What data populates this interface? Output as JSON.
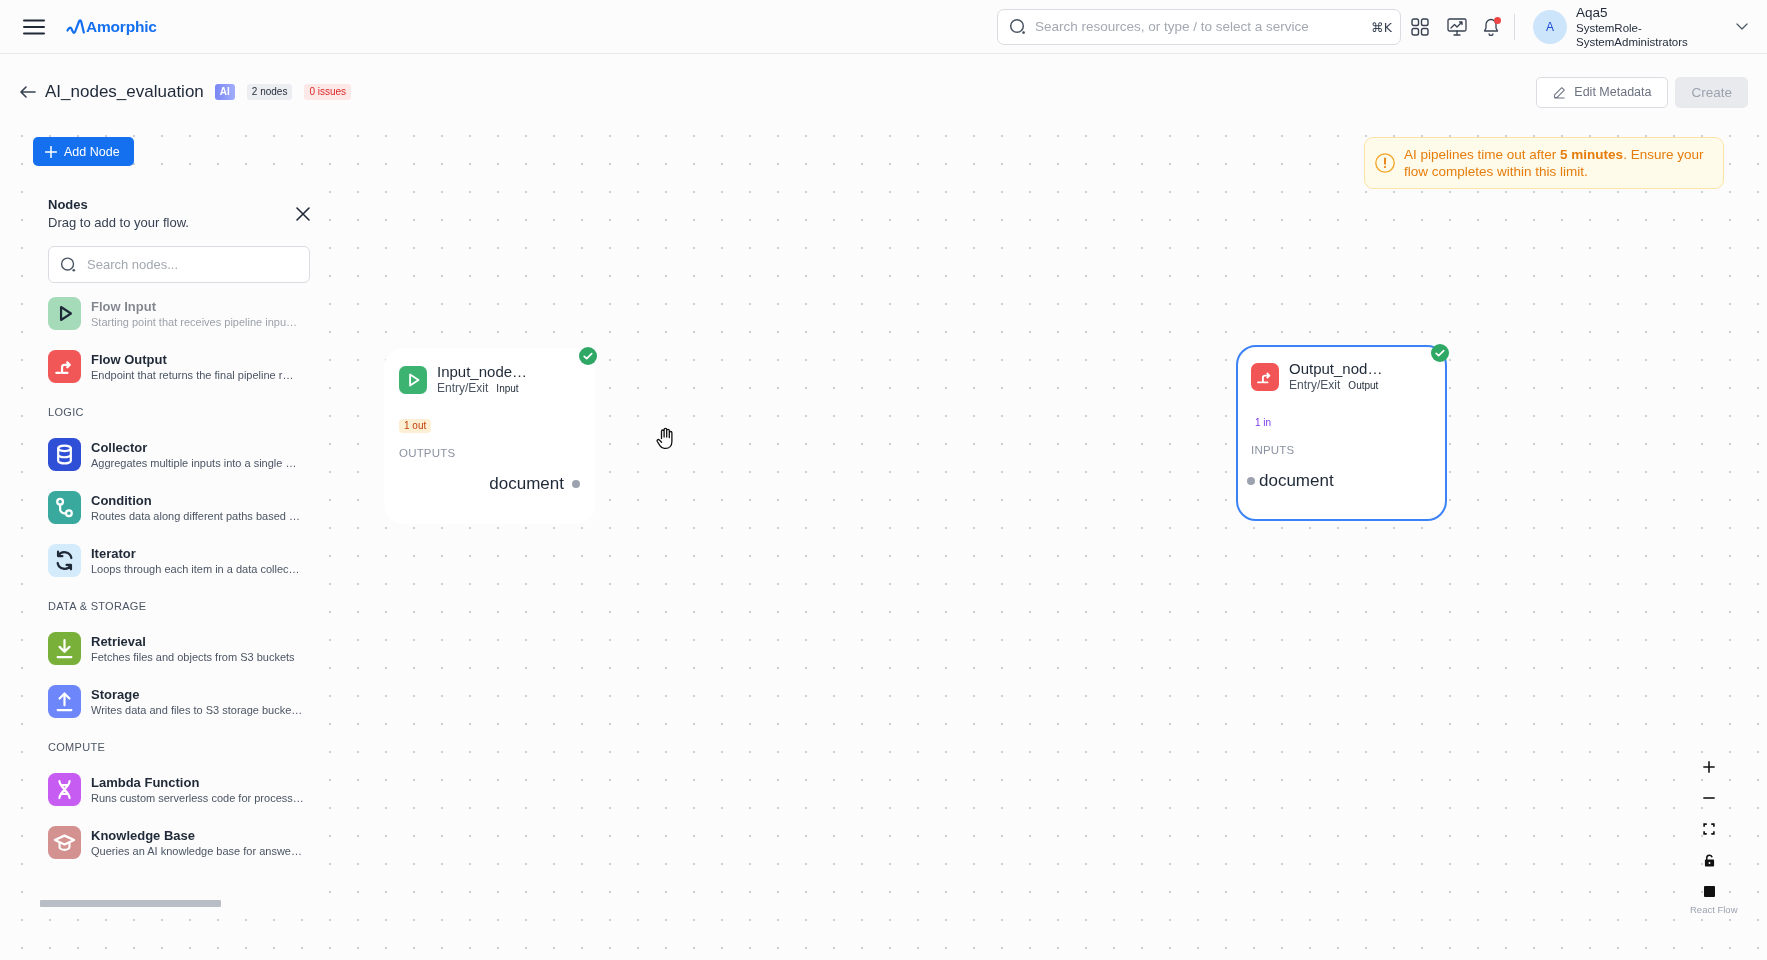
{
  "top_bar": {
    "logo": "Amorphic",
    "search": {
      "placeholder": "Search resources, or type / to select a service",
      "shortcut": "⌘K"
    },
    "notifications": {
      "unread": true
    },
    "user": {
      "avatar": "A",
      "name": "Aqa5",
      "role": "SystemRole-SystemAdministrators"
    }
  },
  "page_header": {
    "title": "AI_nodes_evaluation",
    "badges": [
      {
        "label": "AI",
        "kind": "ai"
      },
      {
        "label": "2 nodes",
        "kind": "count"
      },
      {
        "label": "0 issues",
        "kind": "issues"
      }
    ],
    "buttons": [
      {
        "label": "Edit Metadata",
        "kind": "outline",
        "disabled": false
      },
      {
        "label": "Create",
        "kind": "primary",
        "disabled": true
      }
    ]
  },
  "add_node_button": {
    "label": "Add Node"
  },
  "nodes_panel": {
    "title": "Nodes",
    "subtitle": "Drag to add to your flow.",
    "search": {
      "placeholder": "Search nodes..."
    },
    "sections": [
      {
        "items": [
          {
            "kind": "input",
            "name": "Flow Input",
            "description": "Starting point that receives pipeline inpu…",
            "color": "#a6dbb9"
          },
          {
            "kind": "output",
            "name": "Flow Output",
            "description": "Endpoint that returns the final pipeline r…",
            "color": "#f25757"
          }
        ]
      },
      {
        "heading": "LOGIC",
        "items": [
          {
            "kind": "collector",
            "name": "Collector",
            "description": "Aggregates multiple inputs into a single …",
            "color": "#2e4fd6"
          },
          {
            "kind": "condition",
            "name": "Condition",
            "description": "Routes data along different paths based …",
            "color": "#3aa99d"
          },
          {
            "kind": "iterator",
            "name": "Iterator",
            "description": "Loops through each item in a data collec…",
            "color": "#d4ebfb"
          }
        ]
      },
      {
        "heading": "DATA & STORAGE",
        "items": [
          {
            "kind": "retrieval",
            "name": "Retrieval",
            "description": "Fetches files and objects from S3 buckets",
            "color": "#79b03a"
          },
          {
            "kind": "storage",
            "name": "Storage",
            "description": "Writes data and files to S3 storage bucke…",
            "color": "#6d87fa"
          }
        ]
      },
      {
        "heading": "COMPUTE",
        "items": [
          {
            "kind": "lambda",
            "name": "Lambda Function",
            "description": "Runs custom serverless code for process…",
            "color": "#c65cf2"
          },
          {
            "kind": "knowledge",
            "name": "Knowledge Base",
            "description": "Queries an AI knowledge base for answe…",
            "color": "#d39290"
          }
        ]
      }
    ]
  },
  "canvas": {
    "warning": "AI pipelines time out after **5 minutes**. Ensure your flow completes within this limit.",
    "nodes": [
      {
        "kind": "input",
        "title": "Input_node…",
        "category": "Entry/Exit",
        "tag": "Input",
        "color": "#3cb371",
        "valid": true,
        "selected": false,
        "port_count": "1 out",
        "port_section": "OUTPUTS",
        "ports": [
          "document"
        ]
      },
      {
        "kind": "output",
        "title": "Output_nod…",
        "category": "Entry/Exit",
        "tag": "Output",
        "color": "#f25555",
        "valid": true,
        "selected": true,
        "port_count": "1 in",
        "port_section": "INPUTS",
        "ports": [
          "document"
        ]
      }
    ],
    "controls": {
      "locked": false,
      "attribution": "React Flow"
    }
  }
}
